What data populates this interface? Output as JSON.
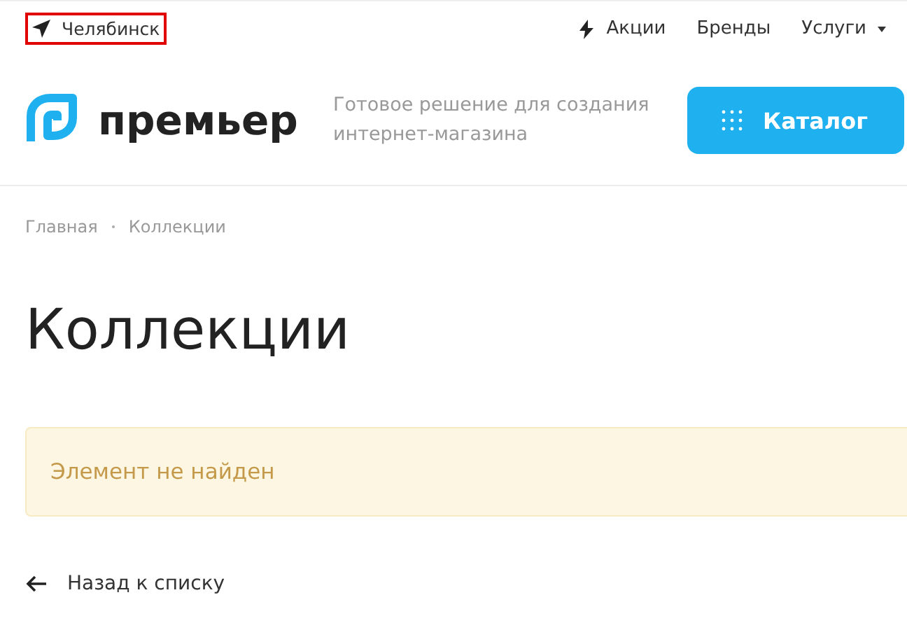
{
  "topbar": {
    "city": {
      "label": "Челябинск",
      "highlighted": true
    },
    "links": [
      {
        "label": "Акции",
        "kind": "promo"
      },
      {
        "label": "Бренды",
        "kind": "plain"
      },
      {
        "label": "Услуги",
        "kind": "dropdown"
      }
    ]
  },
  "header": {
    "logo": "премьер",
    "tagline": "Готовое решение для создания интернет-магазина",
    "catalog_button": "Каталог"
  },
  "breadcrumbs": [
    {
      "label": "Главная"
    },
    {
      "label": "Коллекции"
    }
  ],
  "page_title": "Коллекции",
  "alert": {
    "text": "Элемент не найден"
  },
  "back_link": "Назад к списку"
}
